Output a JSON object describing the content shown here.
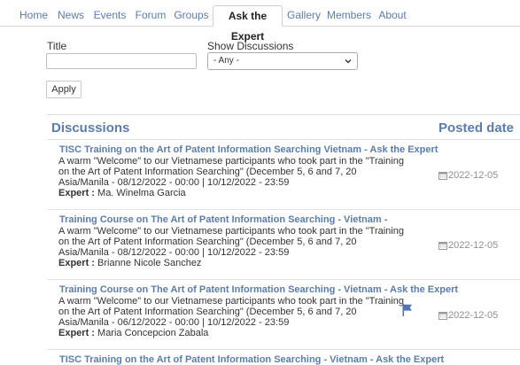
{
  "nav": {
    "tabs": [
      {
        "label": "Home"
      },
      {
        "label": "News"
      },
      {
        "label": "Events"
      },
      {
        "label": "Forum"
      },
      {
        "label": "Groups"
      },
      {
        "label": "Ask the Expert",
        "active": true
      },
      {
        "label": "Gallery"
      },
      {
        "label": "Members"
      },
      {
        "label": "About"
      }
    ]
  },
  "filters": {
    "title_label": "Title",
    "title_value": "",
    "show_label": "Show Discussions",
    "show_value": "- Any -",
    "apply_label": "Apply"
  },
  "table": {
    "col_discussions": "Discussions",
    "col_posted": "Posted date",
    "rows": [
      {
        "title": "TISC Training on the Art of Patent Information Searching Vietnam - Ask the Expert",
        "desc": "A warm \"Welcome\" to our Vietnamese participants who took part in the \"Training on the Art of Patent Information Searching\" (December 5, 6 and 7, 20",
        "tz": "Asia/Manila - 08/12/2022 - 00:00 | 10/12/2022 - 23:59",
        "expert_label": "Expert :",
        "expert": "Ma. Winelma Garcia",
        "date": "2022-12-05",
        "flagged": false
      },
      {
        "title": "Training Course on The Art of Patent Information Searching - Vietnam -",
        "desc": "A warm \"Welcome\" to our Vietnamese participants who took part in the \"Training on the Art of Patent Information Searching\" (December 5, 6 and 7, 20",
        "tz": "Asia/Manila - 08/12/2022 - 00:00 | 10/12/2022 - 23:59",
        "expert_label": "Expert :",
        "expert": "Brianne Nicole Sanchez",
        "date": "2022-12-05",
        "flagged": false
      },
      {
        "title": "Training Course on The Art of Patent Information Searching - Vietnam - Ask the Expert",
        "desc": "A warm \"Welcome\" to our Vietnamese participants who took part in the \"Training on the Art of Patent Information Searching\" (December 5, 6 and 7, 20",
        "tz": "Asia/Manila - 06/12/2022 - 00:00 | 10/12/2022 - 23:59",
        "expert_label": "Expert :",
        "expert": "Maria Concepcion Zabala",
        "date": "2022-12-05",
        "flagged": true
      },
      {
        "title": "TISC Training on the Art of Patent Information Searching - Vietnam - Ask the Expert"
      }
    ]
  },
  "colors": {
    "link": "#5b7dab",
    "flag": "#4f76b3",
    "muted": "#8f8f8f"
  },
  "icons": {
    "calendar": "calendar-icon",
    "flag": "flag-icon",
    "chevron": "chevron-down-icon"
  }
}
